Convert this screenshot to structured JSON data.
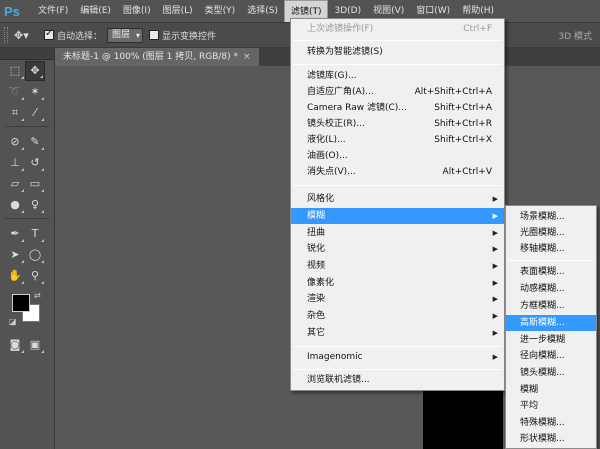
{
  "app": {
    "logo": "Ps"
  },
  "menubar": {
    "items": [
      {
        "label": "文件(F)"
      },
      {
        "label": "编辑(E)"
      },
      {
        "label": "图像(I)"
      },
      {
        "label": "图层(L)"
      },
      {
        "label": "类型(Y)"
      },
      {
        "label": "选择(S)"
      },
      {
        "label": "滤镜(T)"
      },
      {
        "label": "3D(D)"
      },
      {
        "label": "视图(V)"
      },
      {
        "label": "窗口(W)"
      },
      {
        "label": "帮助(H)"
      }
    ],
    "active": "滤镜(T)"
  },
  "options": {
    "auto_select_label": "自动选择：",
    "auto_select_checked": true,
    "auto_select_value": "图层",
    "transform_label": "显示变换控件",
    "transform_checked": false,
    "mode_3d": "3D 模式"
  },
  "document": {
    "tab_title": "未标题-1 @ 100% (图层 1 拷贝, RGB/8) *",
    "close": "×"
  },
  "filter_menu": {
    "last_filter": {
      "label": "上次滤镜操作(F)",
      "shortcut": "Ctrl+F"
    },
    "smart": {
      "label": "转换为智能滤镜(S)"
    },
    "gallery": [
      {
        "label": "滤镜库(G)...",
        "shortcut": ""
      },
      {
        "label": "自适应广角(A)...",
        "shortcut": "Alt+Shift+Ctrl+A"
      },
      {
        "label": "Camera Raw 滤镜(C)...",
        "shortcut": "Shift+Ctrl+A"
      },
      {
        "label": "镜头校正(R)...",
        "shortcut": "Shift+Ctrl+R"
      },
      {
        "label": "液化(L)...",
        "shortcut": "Shift+Ctrl+X"
      },
      {
        "label": "油画(O)...",
        "shortcut": ""
      },
      {
        "label": "消失点(V)...",
        "shortcut": "Alt+Ctrl+V"
      }
    ],
    "categories": [
      {
        "label": "风格化"
      },
      {
        "label": "模糊"
      },
      {
        "label": "扭曲"
      },
      {
        "label": "锐化"
      },
      {
        "label": "视频"
      },
      {
        "label": "像素化"
      },
      {
        "label": "渲染"
      },
      {
        "label": "杂色"
      },
      {
        "label": "其它"
      }
    ],
    "highlighted": "模糊",
    "plugin": {
      "label": "Imagenomic"
    },
    "browse": {
      "label": "浏览联机滤镜..."
    }
  },
  "blur_submenu": {
    "items": [
      {
        "label": "场景模糊..."
      },
      {
        "label": "光圈模糊..."
      },
      {
        "label": "移轴模糊..."
      },
      {
        "label": "表面模糊..."
      },
      {
        "label": "动感模糊..."
      },
      {
        "label": "方框模糊..."
      },
      {
        "label": "高斯模糊..."
      },
      {
        "label": "进一步模糊"
      },
      {
        "label": "径向模糊..."
      },
      {
        "label": "镜头模糊..."
      },
      {
        "label": "模糊"
      },
      {
        "label": "平均"
      },
      {
        "label": "特殊模糊..."
      },
      {
        "label": "形状模糊..."
      }
    ],
    "highlighted": "高斯模糊..."
  },
  "colors": {
    "highlight": "#3399ff",
    "foreground": "#000000",
    "background": "#ffffff"
  }
}
